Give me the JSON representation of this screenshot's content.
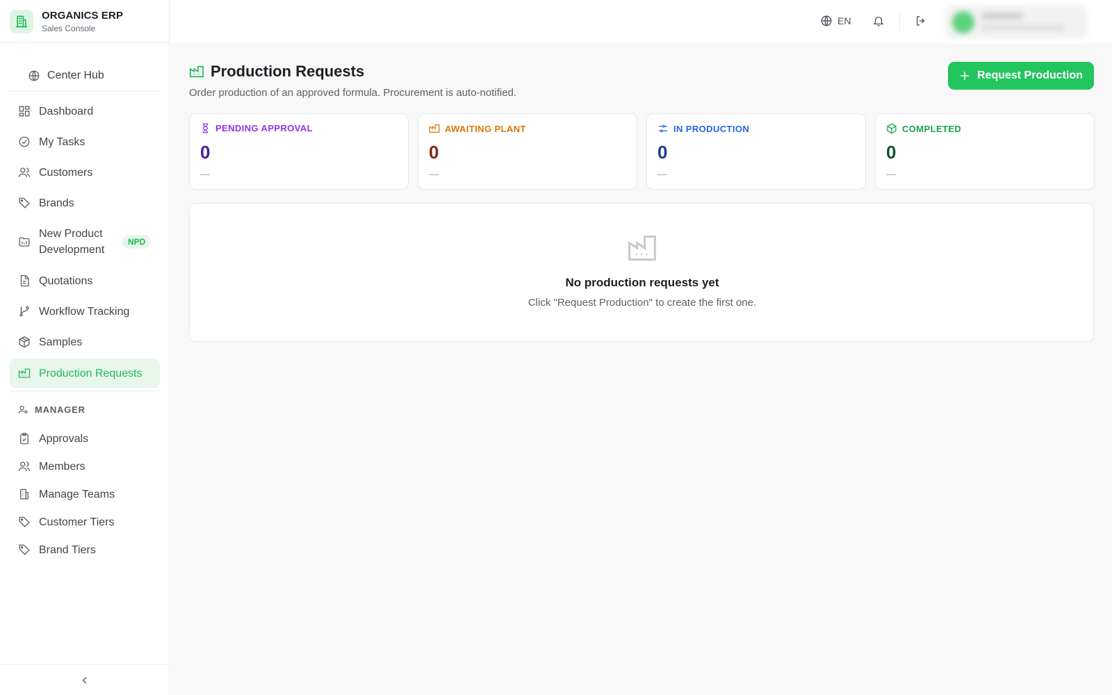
{
  "app": {
    "title": "ORGANICS ERP",
    "subtitle": "Sales Console"
  },
  "sidebar": {
    "hub": {
      "label": "Center Hub",
      "icon": "globe-icon"
    },
    "items": [
      {
        "label": "Dashboard",
        "icon": "dashboard-icon"
      },
      {
        "label": "My Tasks",
        "icon": "check-circle-icon"
      },
      {
        "label": "Customers",
        "icon": "users-icon"
      },
      {
        "label": "Brands",
        "icon": "tag-icon"
      },
      {
        "label": "New Product Development",
        "icon": "folder-chart-icon",
        "badge": "NPD"
      },
      {
        "label": "Quotations",
        "icon": "document-icon"
      },
      {
        "label": "Workflow Tracking",
        "icon": "git-branch-icon"
      },
      {
        "label": "Samples",
        "icon": "package-icon"
      },
      {
        "label": "Production Requests",
        "icon": "factory-icon",
        "active": true
      }
    ],
    "manager_section": "MANAGER",
    "manager_items": [
      {
        "label": "Approvals",
        "icon": "clipboard-check-icon"
      },
      {
        "label": "Members",
        "icon": "users-icon"
      },
      {
        "label": "Manage Teams",
        "icon": "building-icon"
      },
      {
        "label": "Customer Tiers",
        "icon": "tag-icon"
      },
      {
        "label": "Brand Tiers",
        "icon": "tag-icon"
      }
    ]
  },
  "topbar": {
    "language": "EN"
  },
  "page": {
    "title": "Production Requests",
    "subtitle": "Order production of an approved formula. Procurement is auto-notified.",
    "primary_button": "Request Production"
  },
  "stats": [
    {
      "label": "PENDING APPROVAL",
      "value": "0",
      "note": "—",
      "color": "#9333ea",
      "value_color": "#4c1d95",
      "icon": "hourglass-icon"
    },
    {
      "label": "AWAITING PLANT",
      "value": "0",
      "note": "—",
      "color": "#d97706",
      "value_color": "#7c2d12",
      "icon": "factory-icon"
    },
    {
      "label": "IN PRODUCTION",
      "value": "0",
      "note": "—",
      "color": "#2563eb",
      "value_color": "#1e3a8a",
      "icon": "sliders-icon"
    },
    {
      "label": "COMPLETED",
      "value": "0",
      "note": "—",
      "color": "#16a34a",
      "value_color": "#14532d",
      "icon": "package-check-icon"
    }
  ],
  "empty_state": {
    "title": "No production requests yet",
    "message": "Click \"Request Production\" to create the first one."
  },
  "colors": {
    "accent": "#22c55e",
    "accent_soft": "#e8f6ec"
  }
}
